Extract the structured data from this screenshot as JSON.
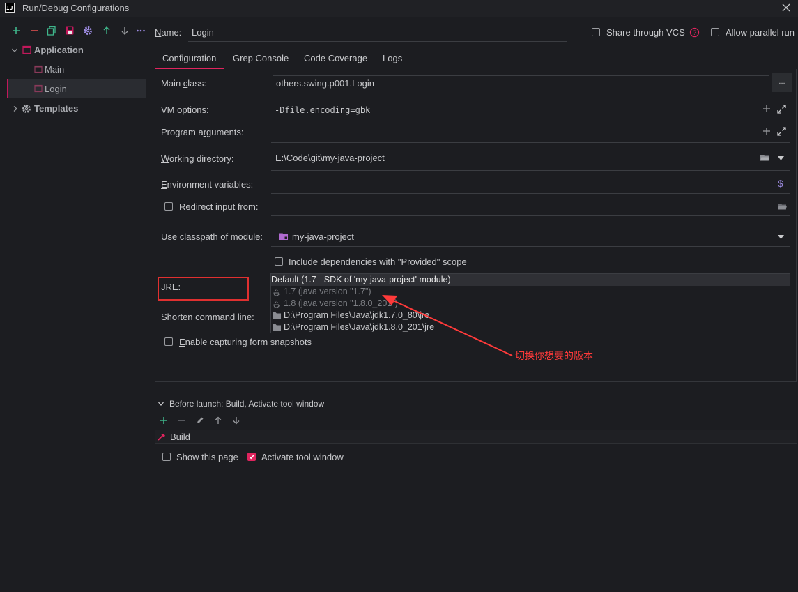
{
  "window": {
    "title": "Run/Debug Configurations",
    "logo_text": "IJ"
  },
  "tree": {
    "application": "Application",
    "main": "Main",
    "login": "Login",
    "templates": "Templates"
  },
  "name_row": {
    "label": "Name:",
    "value": "Login",
    "share_vcs": "Share through VCS",
    "allow_parallel": "Allow parallel run"
  },
  "tabs": [
    "Configuration",
    "Grep Console",
    "Code Coverage",
    "Logs"
  ],
  "form": {
    "main_class_label": "Main class:",
    "main_class_value": "others.swing.p001.Login",
    "browse_label": "...",
    "vm_options_label": "VM options:",
    "vm_options_value": "-Dfile.encoding=gbk",
    "program_args_label": "Program arguments:",
    "working_dir_label": "Working directory:",
    "working_dir_value": "E:\\Code\\git\\my-java-project",
    "env_vars_label": "Environment variables:",
    "redirect_label": "Redirect input from:",
    "classpath_label": "Use classpath of module:",
    "classpath_value": "my-java-project",
    "include_deps_label": "Include dependencies with \"Provided\" scope",
    "jre_label": "JRE:",
    "shorten_label": "Shorten command line:",
    "enable_snapshots_label": "Enable capturing form snapshots"
  },
  "jre_options": [
    "Default (1.7 - SDK of 'my-java-project' module)",
    "1.7 (java version \"1.7\")",
    "1.8 (java version \"1.8.0_201\")",
    "D:\\Program Files\\Java\\jdk1.7.0_80\\jre",
    "D:\\Program Files\\Java\\jdk1.8.0_201\\jre"
  ],
  "annotation": "切换你想要的版本",
  "before_launch": {
    "header": "Before launch: Build, Activate tool window",
    "build_item": "Build",
    "show_page": "Show this page",
    "activate_tool_window": "Activate tool window"
  },
  "colors": {
    "accent": "#e0245e",
    "annotation_red": "#ff3a3a",
    "green_icon": "#3fb68b",
    "background": "#1c1d21"
  }
}
